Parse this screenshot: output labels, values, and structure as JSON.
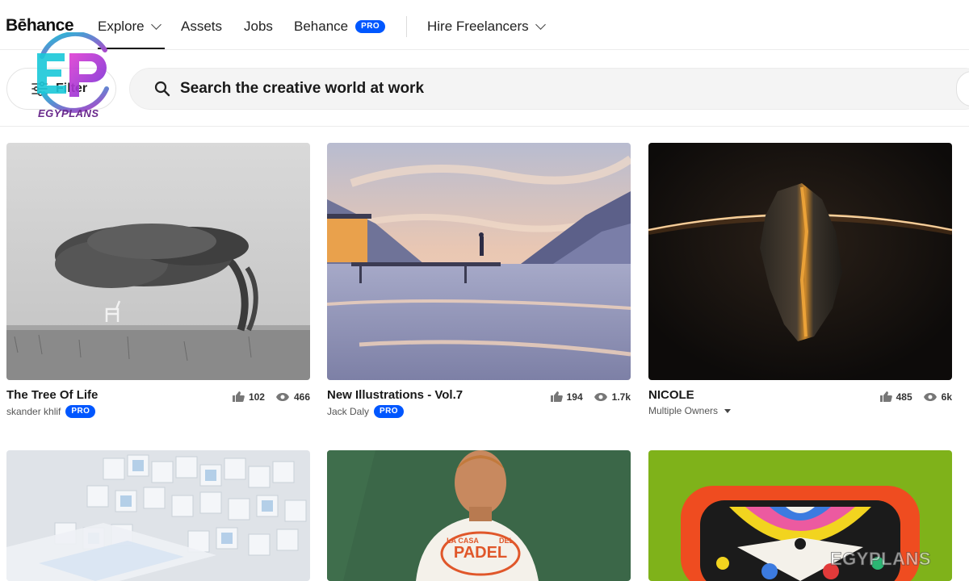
{
  "nav": {
    "brand": "Bēhance",
    "explore": "Explore",
    "assets": "Assets",
    "jobs": "Jobs",
    "behance_pro_label": "Behance",
    "pro_badge": "PRO",
    "hire": "Hire Freelancers"
  },
  "filter": {
    "label": "Filter"
  },
  "search": {
    "placeholder": "Search the creative world at work"
  },
  "watermark": {
    "logo_letters": "EP",
    "logo_word": "EGYPLANS",
    "corner_text": "EGYPLANS"
  },
  "projects": [
    {
      "title": "The Tree Of Life",
      "owner": "skander khlif",
      "pro": "PRO",
      "likes": "102",
      "views": "466"
    },
    {
      "title": "New Illustrations - Vol.7",
      "owner": "Jack Daly",
      "pro": "PRO",
      "likes": "194",
      "views": "1.7k"
    },
    {
      "title": "NICOLE",
      "owner": "Multiple Owners",
      "likes": "485",
      "views": "6k"
    },
    {
      "title": ""
    },
    {
      "title": "",
      "shirt_text": "LA CASA DEL PADEL"
    },
    {
      "title": ""
    }
  ],
  "colors": {
    "accent": "#0057ff",
    "text": "#191919"
  }
}
